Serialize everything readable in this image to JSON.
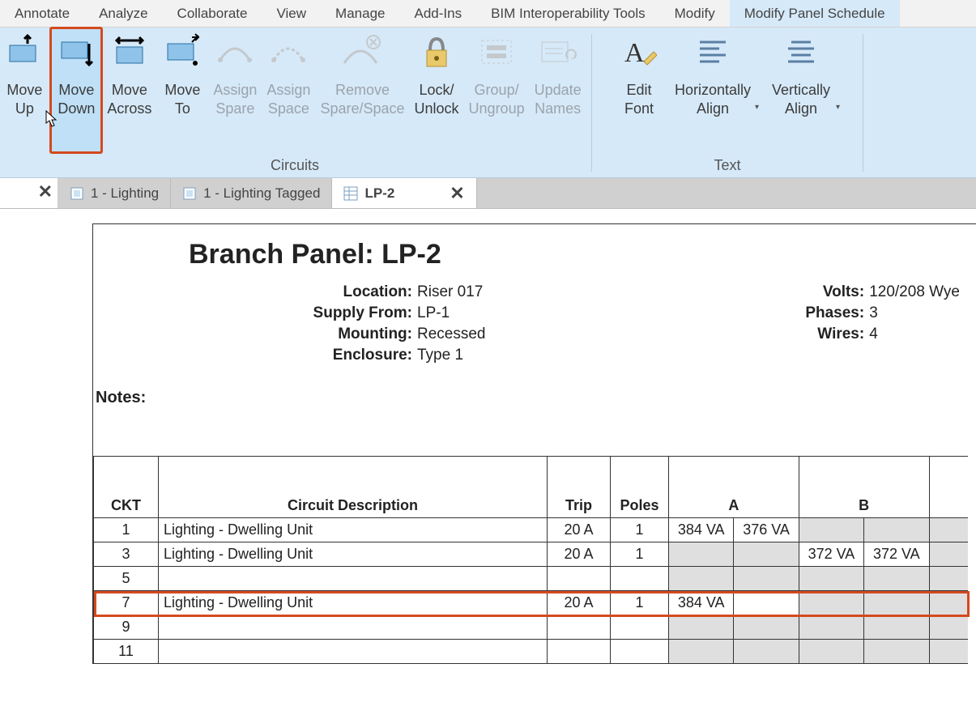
{
  "ribbon": {
    "tabs": [
      "Annotate",
      "Analyze",
      "Collaborate",
      "View",
      "Manage",
      "Add-Ins",
      "BIM Interoperability Tools",
      "Modify",
      "Modify Panel Schedule"
    ],
    "active_tab_index": 8,
    "buttons": {
      "move_up": "Move\nUp",
      "move_down": "Move\nDown",
      "move_across": "Move\nAcross",
      "move_to": "Move\nTo",
      "assign_spare": "Assign\nSpare",
      "assign_space": "Assign\nSpace",
      "remove_spare": "Remove\nSpare/Space",
      "lock_unlock": "Lock/\nUnlock",
      "group_ungroup": "Group/\nUngroup",
      "update_names": "Update\nNames",
      "edit_font": "Edit\nFont",
      "h_align": "Horizontally\nAlign",
      "v_align": "Vertically\nAlign"
    },
    "group_labels": {
      "circuits": "Circuits",
      "text": "Text"
    }
  },
  "doc_tabs": {
    "t1": "1 - Lighting",
    "t2": "1 - Lighting Tagged",
    "t3": "LP-2",
    "close": "✕"
  },
  "panel": {
    "title": "Branch Panel: LP-2",
    "left": [
      {
        "k": "Location:",
        "v": "Riser 017"
      },
      {
        "k": "Supply From:",
        "v": "LP-1"
      },
      {
        "k": "Mounting:",
        "v": "Recessed"
      },
      {
        "k": "Enclosure:",
        "v": "Type 1"
      }
    ],
    "right": [
      {
        "k": "Volts:",
        "v": "120/208 Wye"
      },
      {
        "k": "Phases:",
        "v": "3"
      },
      {
        "k": "Wires:",
        "v": "4"
      }
    ],
    "notes_label": "Notes:"
  },
  "table": {
    "headers": {
      "ckt": "CKT",
      "desc": "Circuit Description",
      "trip": "Trip",
      "poles": "Poles",
      "a": "A",
      "b": "B"
    },
    "rows": [
      {
        "ckt": "1",
        "desc": "Lighting - Dwelling Unit",
        "trip": "20 A",
        "poles": "1",
        "a1": "384 VA",
        "a2": "376 VA",
        "b1": "",
        "b2": "",
        "a_grey": false,
        "b_grey": true
      },
      {
        "ckt": "3",
        "desc": "Lighting - Dwelling Unit",
        "trip": "20 A",
        "poles": "1",
        "a1": "",
        "a2": "",
        "b1": "372 VA",
        "b2": "372 VA",
        "a_grey": true,
        "b_grey": false
      },
      {
        "ckt": "5",
        "desc": "",
        "trip": "",
        "poles": "",
        "a1": "",
        "a2": "",
        "b1": "",
        "b2": "",
        "a_grey": true,
        "b_grey": true
      },
      {
        "ckt": "7",
        "desc": "Lighting - Dwelling Unit",
        "trip": "20 A",
        "poles": "1",
        "a1": "384 VA",
        "a2": "",
        "b1": "",
        "b2": "",
        "a_grey": false,
        "b_grey": true,
        "highlight": true
      },
      {
        "ckt": "9",
        "desc": "",
        "trip": "",
        "poles": "",
        "a1": "",
        "a2": "",
        "b1": "",
        "b2": "",
        "a_grey": true,
        "b_grey": true
      },
      {
        "ckt": "11",
        "desc": "",
        "trip": "",
        "poles": "",
        "a1": "",
        "a2": "",
        "b1": "",
        "b2": "",
        "a_grey": true,
        "b_grey": true
      }
    ]
  }
}
